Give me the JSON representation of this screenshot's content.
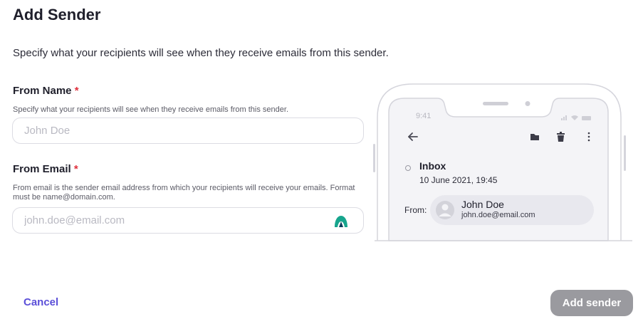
{
  "page": {
    "title": "Add Sender",
    "subtitle": "Specify what your recipients will see when they receive emails from this sender."
  },
  "form": {
    "from_name": {
      "label": "From Name",
      "required_marker": "*",
      "help": "Specify what your recipients will see when they receive emails from this sender.",
      "value": "",
      "placeholder": "John Doe"
    },
    "from_email": {
      "label": "From Email",
      "required_marker": "*",
      "help": "From email is the sender email address from which your recipients will receive your emails. Format must be name@domain.com.",
      "value": "",
      "placeholder": "john.doe@email.com",
      "autofill_icon": "autofill-extension-icon"
    }
  },
  "preview": {
    "status_time": "9:41",
    "folder": "Inbox",
    "date": "10 June 2021, 19:45",
    "from_label": "From:",
    "sender_name": "John Doe",
    "sender_email": "john.doe@email.com",
    "icons": [
      "back-arrow-icon",
      "folder-icon",
      "trash-icon",
      "more-vertical-icon",
      "avatar-icon"
    ]
  },
  "actions": {
    "cancel_label": "Cancel",
    "submit_label": "Add sender"
  },
  "colors": {
    "primary_text": "#1f1f2b",
    "required": "#e0303d",
    "link": "#5b4fd8",
    "submit_disabled_bg": "#9a9a9f",
    "autofill_icon": "#17a58d"
  }
}
